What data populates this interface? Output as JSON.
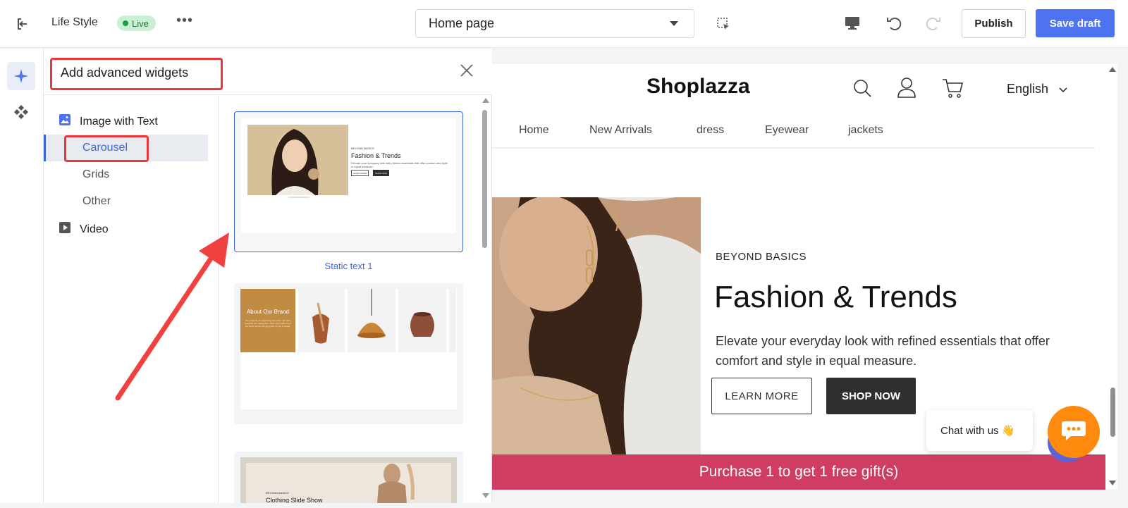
{
  "topbar": {
    "store_name": "Life Style",
    "live_label": "Live",
    "more": "•••",
    "page_selector": "Home page",
    "publish_label": "Publish",
    "save_draft_label": "Save draft"
  },
  "panel": {
    "title": "Add advanced widgets",
    "groups": [
      {
        "label": "Image with Text",
        "icon": "image-icon"
      },
      {
        "label": "Video",
        "icon": "video-play-icon"
      }
    ],
    "items": [
      {
        "label": "Carousel",
        "active": true
      },
      {
        "label": "Grids",
        "active": false
      },
      {
        "label": "Other",
        "active": false
      }
    ],
    "cards": [
      {
        "label": "Static text 1",
        "eyebrow": "BEYOND BASICS",
        "title": "Fashion & Trends",
        "desc": "Elevate your everyday look with refined essentials that offer comfort and style in equal measure.",
        "btn1": "LEARN MORE",
        "btn2": "SHOP NOW"
      },
      {
        "title": "About Our Brand",
        "desc": "Our products are inspired by the world. We have searched the marketplace, lifted artist platforms of the world and are bringing them to you to shape."
      },
      {
        "eyebrow": "BEYOND BASICS",
        "title": "Clothing Slide Show"
      }
    ]
  },
  "preview": {
    "brand": "Shoplazza",
    "language": "English",
    "nav": [
      "Home",
      "New Arrivals",
      "dress",
      "Eyewear",
      "jackets"
    ],
    "eyebrow": "BEYOND BASICS",
    "title": "Fashion & Trends",
    "desc": "Elevate your everyday look with refined essentials that offer comfort and style in equal measure.",
    "learn_more": "LEARN MORE",
    "shop_now": "SHOP NOW",
    "promo": "Purchase 1 to get 1 free gift(s)",
    "chat_label": "Chat with us 👋"
  },
  "colors": {
    "accent": "#4e73f0",
    "highlight": "#e8373b",
    "promo": "#cf3d62",
    "chat": "#ff8a0d"
  }
}
